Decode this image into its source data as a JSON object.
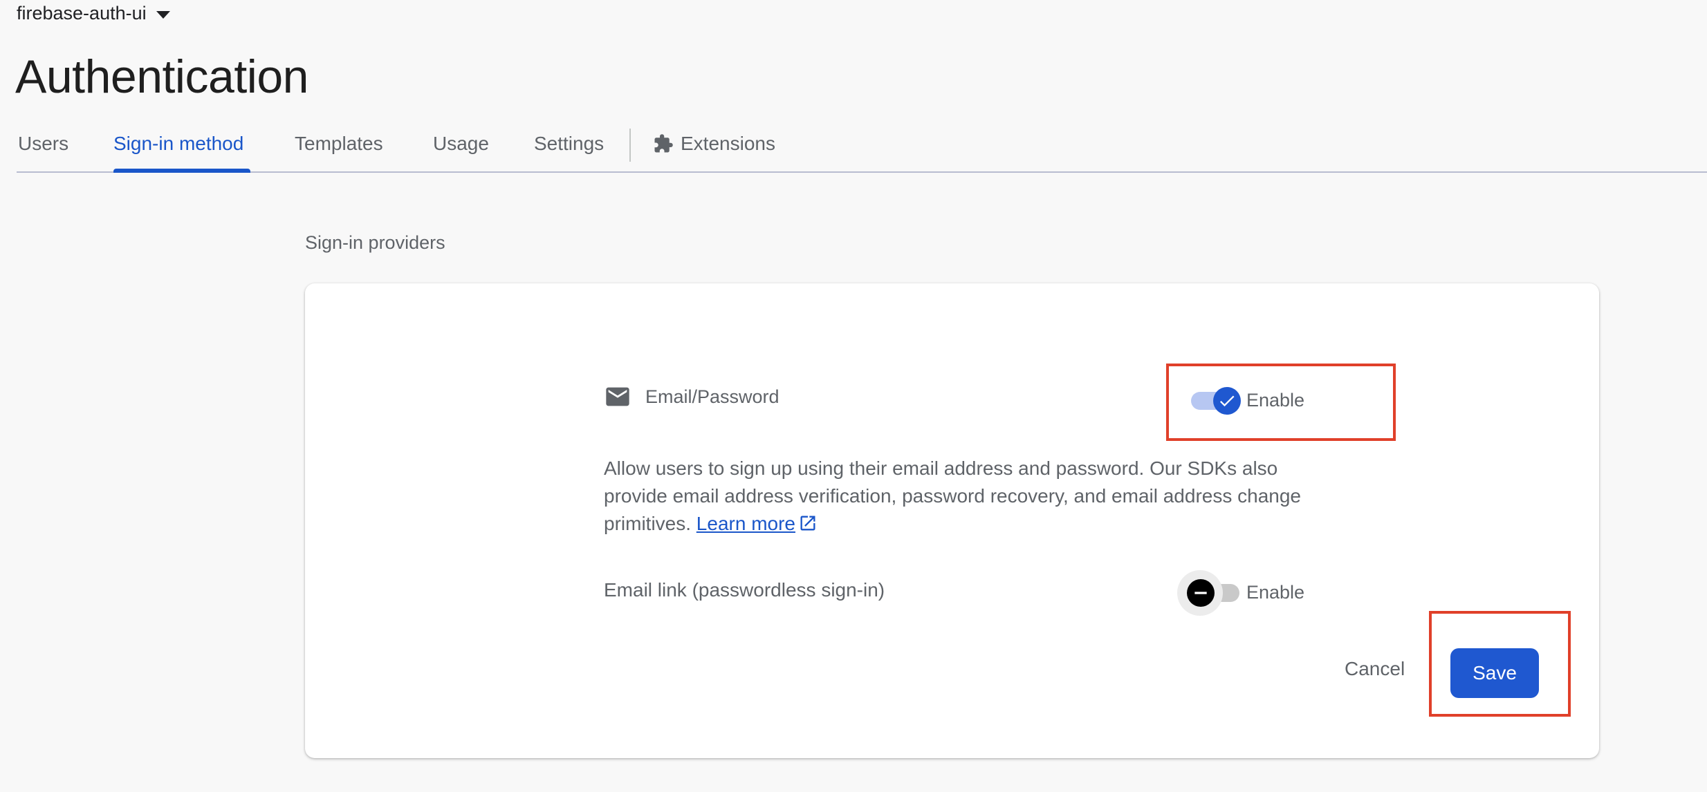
{
  "project": {
    "name": "firebase-auth-ui"
  },
  "page": {
    "title": "Authentication"
  },
  "tabs": [
    {
      "label": "Users"
    },
    {
      "label": "Sign-in method",
      "active": true
    },
    {
      "label": "Templates"
    },
    {
      "label": "Usage"
    },
    {
      "label": "Settings"
    },
    {
      "label": "Extensions",
      "icon": "extensions-icon"
    }
  ],
  "section": {
    "title": "Sign-in providers"
  },
  "providers": {
    "email_password": {
      "label": "Email/Password",
      "icon": "mail-icon",
      "toggle_label": "Enable",
      "enabled": true,
      "description": "Allow users to sign up using their email address and password. Our SDKs also provide email address verification, password recovery, and email address change primitives.",
      "learn_more": "Learn more"
    },
    "email_link": {
      "label": "Email link (passwordless sign-in)",
      "toggle_label": "Enable",
      "enabled": false
    }
  },
  "actions": {
    "cancel": "Cancel",
    "save": "Save"
  },
  "colors": {
    "accent": "#1a56c9",
    "highlight": "#e0402a",
    "save_bg": "#1f58d0"
  }
}
